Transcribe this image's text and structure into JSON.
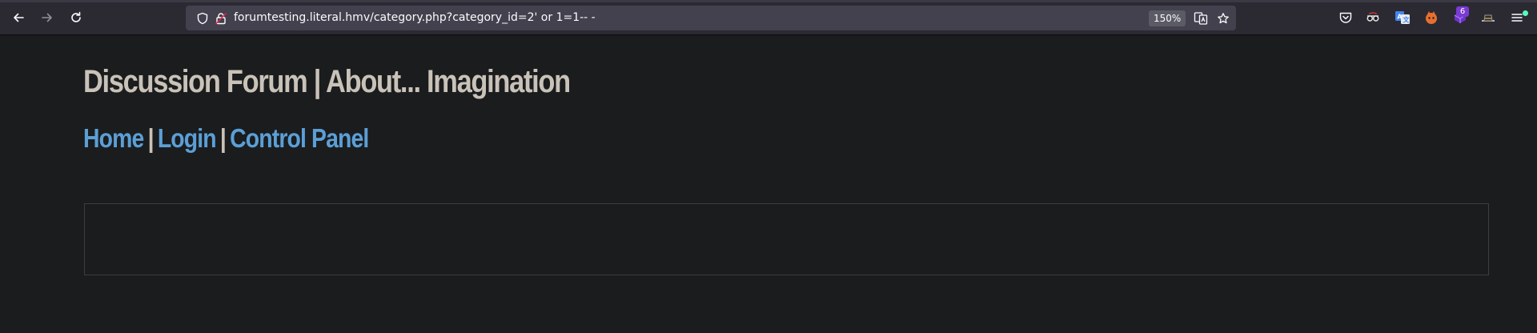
{
  "browser": {
    "url": "forumtesting.literal.hmv/category.php?category_id=2' or 1=1-- -",
    "zoom": "150%",
    "icons": {
      "back": "arrow-left-icon",
      "forward": "arrow-right-icon",
      "reload": "reload-icon",
      "tracking_protection": "shield-icon",
      "connection": "insecure-lock-icon",
      "translate": "translate-icon",
      "bookmark": "star-icon",
      "pocket": "pocket-icon",
      "menu": "hamburger-menu-icon"
    },
    "extension_badge": "6",
    "colors": {
      "toolbar_bg": "#2b2a33",
      "urlbar_bg": "#42414d",
      "update_dot": "#54ffbd"
    }
  },
  "site": {
    "title": "Discussion Forum | About... Imagination",
    "nav": [
      {
        "label": "Home"
      },
      {
        "label": "Login"
      },
      {
        "label": "Control Panel"
      }
    ],
    "separator": "|",
    "colors": {
      "background": "#1b1c1e",
      "title": "#c9c2b8",
      "link": "#5b9fd6"
    }
  }
}
